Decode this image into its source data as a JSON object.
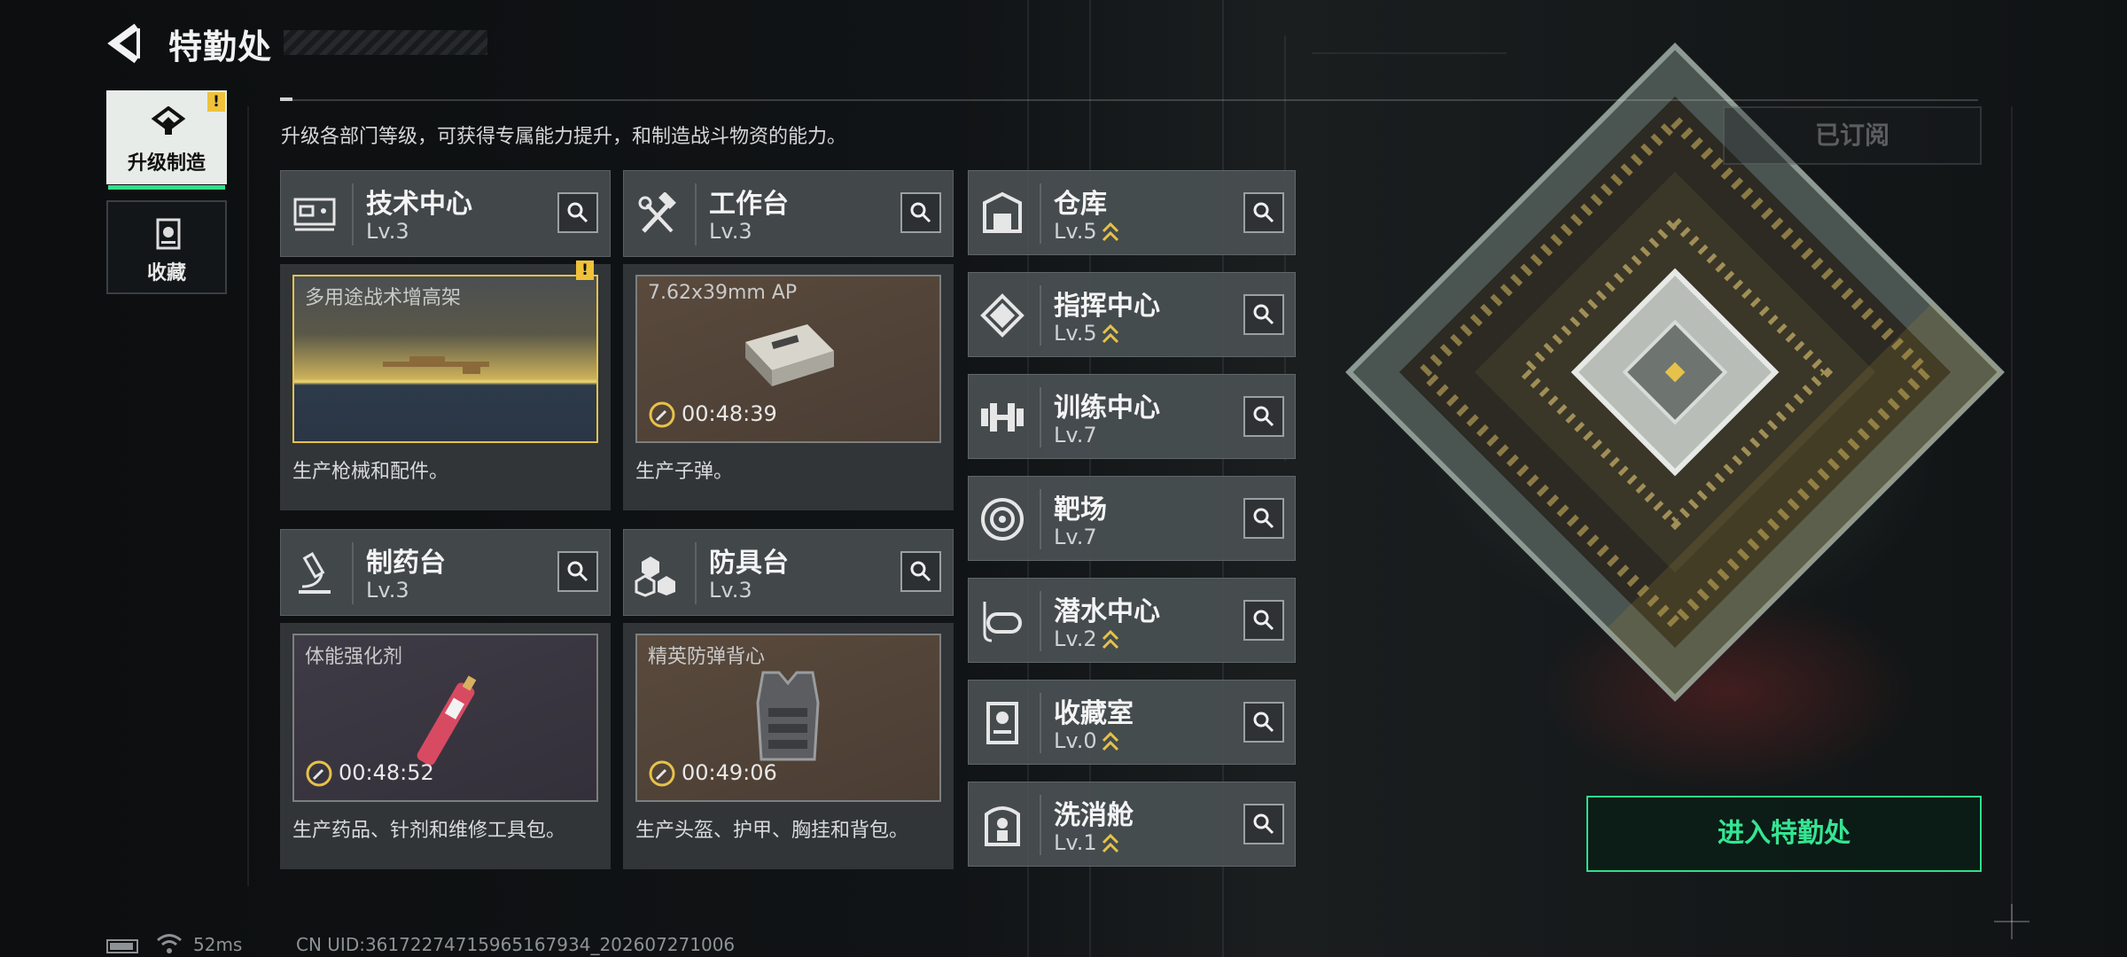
{
  "header": {
    "title": "特勤处"
  },
  "tabs": [
    {
      "label": "升级制造",
      "active": true,
      "warning": "!"
    },
    {
      "label": "收藏",
      "active": false
    }
  ],
  "subtitle": "升级各部门等级，可获得专属能力提升，和制造战斗物资的能力。",
  "cards": [
    {
      "name": "技术中心",
      "level": "Lv.3",
      "product": "多用途战术增高架",
      "timer": "",
      "desc": "生产枪械和配件。",
      "warning": "!"
    },
    {
      "name": "工作台",
      "level": "Lv.3",
      "product": "7.62x39mm AP",
      "timer": "00:48:39",
      "desc": "生产子弹。"
    },
    {
      "name": "制药台",
      "level": "Lv.3",
      "product": "体能强化剂",
      "timer": "00:48:52",
      "desc": "生产药品、针剂和维修工具包。"
    },
    {
      "name": "防具台",
      "level": "Lv.3",
      "product": "精英防弹背心",
      "timer": "00:49:06",
      "desc": "生产头盔、护甲、胸挂和背包。"
    }
  ],
  "rooms": [
    {
      "name": "仓库",
      "level": "Lv.5",
      "icon": "warehouse-icon"
    },
    {
      "name": "指挥中心",
      "level": "Lv.5",
      "icon": "command-chip-icon"
    },
    {
      "name": "训练中心",
      "level": "Lv.7",
      "icon": "dumbbell-icon"
    },
    {
      "name": "靶场",
      "level": "Lv.7",
      "icon": "target-icon"
    },
    {
      "name": "潜水中心",
      "level": "Lv.2",
      "icon": "diving-mask-icon"
    },
    {
      "name": "收藏室",
      "level": "Lv.0",
      "icon": "display-case-icon"
    },
    {
      "name": "洗消舱",
      "level": "Lv.1",
      "icon": "decontamination-icon"
    }
  ],
  "buttons": {
    "subscribed": "已订阅",
    "enter": "进入特勤处"
  },
  "status": {
    "ping": "52ms",
    "uid": "CN UID:36172274715965167934_202607271006"
  },
  "colors": {
    "accent": "#2ee08a",
    "gold": "#e6c24a",
    "warning": "#f0c23a"
  }
}
